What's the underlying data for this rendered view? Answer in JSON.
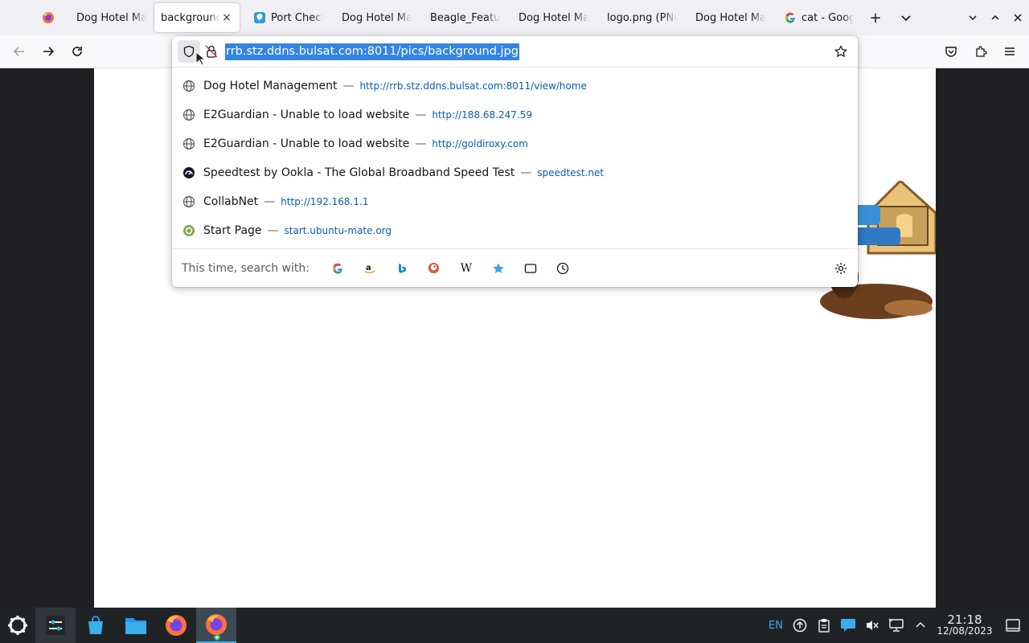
{
  "tabs": [
    {
      "label": "Dog Hotel Ma",
      "icon": "none"
    },
    {
      "label": "background",
      "icon": "none",
      "active": true,
      "close": "×"
    },
    {
      "label": "Port Check",
      "icon": "port-check-icon"
    },
    {
      "label": "Dog Hotel Ma",
      "icon": "none"
    },
    {
      "label": "Beagle_Featur",
      "icon": "none"
    },
    {
      "label": "Dog Hotel Ma",
      "icon": "none"
    },
    {
      "label": "logo.png (PNG",
      "icon": "none"
    },
    {
      "label": "Dog Hotel Ma",
      "icon": "none"
    },
    {
      "label": "cat - Google",
      "icon": "google-icon"
    }
  ],
  "new_tab": "+",
  "url": "rrb.stz.ddns.bulsat.com:8011/pics/background.jpg",
  "results": [
    {
      "title": "Dog Hotel Management",
      "sep": "—",
      "url": "http://rrb.stz.ddns.bulsat.com:8011/view/home",
      "icon": "globe-icon"
    },
    {
      "title": "E2Guardian - Unable to load website",
      "sep": "—",
      "url": "http://188.68.247.59",
      "icon": "globe-icon"
    },
    {
      "title": "E2Guardian - Unable to load website",
      "sep": "—",
      "url": "http://goldiroxy.com",
      "icon": "globe-icon"
    },
    {
      "title": "Speedtest by Ookla - The Global Broadband Speed Test",
      "sep": "—",
      "url": "speedtest.net",
      "icon": "speedtest-icon"
    },
    {
      "title": "CollabNet",
      "sep": "—",
      "url": "http://192.168.1.1",
      "icon": "globe-icon"
    },
    {
      "title": "Start Page",
      "sep": "—",
      "url": "start.ubuntu-mate.org",
      "icon": "ubuntu-mate-icon"
    }
  ],
  "oneoff": {
    "label": "This time, search with:",
    "engines": [
      "google",
      "amazon",
      "bing",
      "duckduckgo",
      "wikipedia",
      "bookmarks",
      "tabs",
      "history"
    ],
    "wiki_glyph": "W"
  },
  "tray": {
    "lang": "EN",
    "time": "21:18",
    "date": "12/08/2023"
  },
  "colors": {
    "accent": "#3584e4",
    "url_link": "#0b5cad",
    "taskbar": "#202326"
  }
}
